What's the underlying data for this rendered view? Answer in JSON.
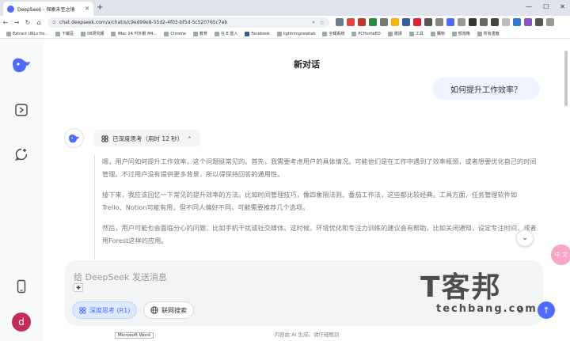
{
  "browser": {
    "tab_title": "DeepSeek - 探索未至之境",
    "url": "chat.deepseek.com/a/chat/s/c9ed99e8-55d2-4f03-bf5d-5c520765c7eb",
    "bookmarks": [
      "Extract URLs fro...",
      "下載區",
      "06研究報",
      "iMac 24 吋外觀 M4...",
      "Chrome",
      "教育",
      "在 E 匯入",
      "Facebook",
      "lightningnewtab",
      "全報系統",
      "PCHomeED",
      "邀請",
      "工具",
      "購物",
      "部落格",
      "所有書籤"
    ]
  },
  "sidebar": {
    "avatar_letter": "d"
  },
  "chat": {
    "title": "新对话",
    "user_message": "如何提升工作效率？",
    "thinking_label": "已深度思考（用时 12 秒）",
    "thinking_paragraphs": [
      "嗯，用户问如何提升工作效率，这个问题挺常见的。首先，我需要考虑用户的具体情况。可能他们是在工作中遇到了效率瓶颈，或者想要优化自己的时间管理。不过用户没有提供更多背景，所以得保持回答的通用性。",
      "接下来，我应该回忆一下常见的提升效率的方法。比如时间管理技巧，像四象限法则、番茄工作法，这些都比较经典。工具方面，任务管理软件如Trello、Notion可能有用，但不同人偏好不同，可能需要推荐几个选项。",
      "然后，用户可能也会面临分心的问题，比如手机干扰或社交媒体。这时候，环境优化和专注力训练的建议会有帮助，比如关闭通知，设定专注时间，或者用Forest这样的应用。"
    ]
  },
  "composer": {
    "placeholder": "给 DeepSeek 发送消息",
    "deep_think_label": "深度思考 (R1)",
    "web_search_label": "联网搜索"
  },
  "footer": {
    "disclaimer": "内容由 AI 生成，请仔细甄别"
  },
  "overlay": {
    "translate_label": "中 文",
    "tooltip": "Microsoft Word",
    "watermark_big": "T客邦",
    "watermark_small": "techbang.com"
  },
  "colors": {
    "accent": "#4d6bfe",
    "avatar_bg": "#c42b58"
  }
}
